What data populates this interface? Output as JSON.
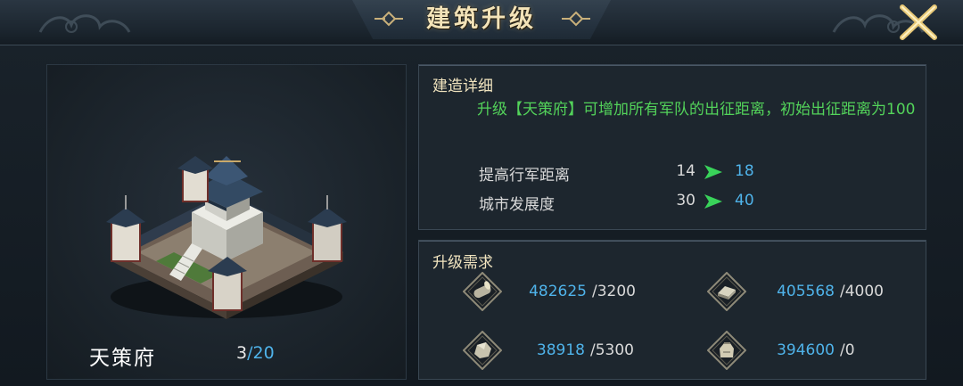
{
  "window": {
    "title": "建筑升级"
  },
  "building": {
    "name": "天策府",
    "level_current": "3",
    "level_max": "/20"
  },
  "details": {
    "heading": "建造详细",
    "description": "升级【天策府】可增加所有军队的出征距离，初始出征距离为100",
    "stats": [
      {
        "label": "提高行军距离",
        "from": "14",
        "to": "18"
      },
      {
        "label": "城市发展度",
        "from": "30",
        "to": "40"
      }
    ]
  },
  "requirements": {
    "heading": "升级需求",
    "resources": [
      {
        "icon": "wood-log-icon",
        "have": "482625",
        "need": "/3200"
      },
      {
        "icon": "iron-ingot-icon",
        "have": "405568",
        "need": "/4000"
      },
      {
        "icon": "stone-ore-icon",
        "have": "38918",
        "need": "/5300"
      },
      {
        "icon": "grain-sack-icon",
        "have": "394600",
        "need": "/0"
      }
    ]
  },
  "colors": {
    "title_gold": "#f3e3b8",
    "description_green": "#53d35a",
    "value_blue": "#4fb3ea",
    "arrow_green": "#39d35a"
  }
}
